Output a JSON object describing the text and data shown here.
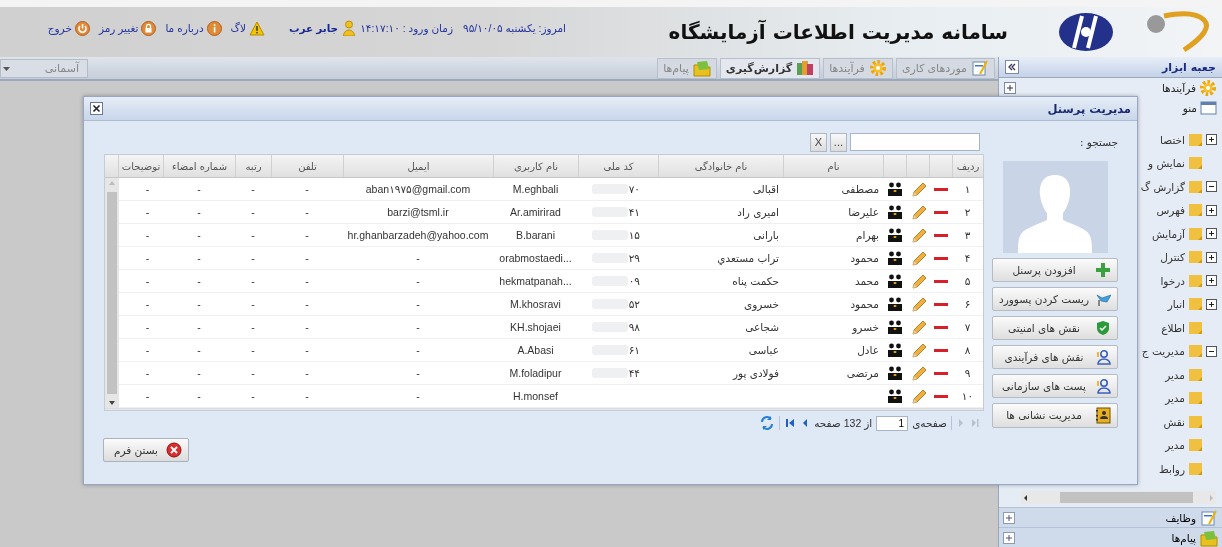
{
  "header": {
    "title": "سامانه مدیریت اطلاعات آزمایشگاه",
    "date": "امروز: یکشنبه ۹۵/۱۰/۰۵",
    "login_time": "زمان ورود : ۱۴:۱۷:۱۰",
    "user": "جابر عرب",
    "links": [
      {
        "label": "لاگ",
        "kind": "warning"
      },
      {
        "label": "درباره ما",
        "kind": "info"
      },
      {
        "label": "تغییر رمز",
        "kind": "lock"
      },
      {
        "label": "خروج",
        "kind": "power"
      }
    ]
  },
  "toolbar": {
    "tabs": [
      {
        "label": "موردهای کاری",
        "selected": false,
        "kind": "tasks"
      },
      {
        "label": "فرآیندها",
        "selected": false,
        "kind": "gear"
      },
      {
        "label": "گزارش‌گیری",
        "selected": true,
        "kind": "report"
      },
      {
        "label": "پیام‌ها",
        "selected": false,
        "kind": "messages"
      }
    ],
    "theme": "آسمانی"
  },
  "sidebar": {
    "title": "جعبه ابزار",
    "sections": [
      {
        "label": "فرآیندها",
        "kind": "gear"
      },
      {
        "label": "منو",
        "kind": "menu"
      }
    ],
    "tree": [
      {
        "label": "اختصا",
        "expanded": false
      },
      {
        "label": "نمایش و"
      },
      {
        "label": "گزارش گ",
        "expanded": true,
        "children": [
          {
            "label": "فهرس",
            "expanded": false
          },
          {
            "label": "آزمایش",
            "expanded": false
          },
          {
            "label": "کنترل",
            "expanded": false
          },
          {
            "label": "درخوا",
            "expanded": false
          },
          {
            "label": "انبار",
            "expanded": false
          },
          {
            "label": "اطلاع"
          }
        ]
      },
      {
        "label": "مدیریت ج",
        "expanded": true,
        "children": [
          {
            "label": "مدیر"
          },
          {
            "label": "مدیر"
          },
          {
            "label": "نقش"
          },
          {
            "label": "مدیر"
          },
          {
            "label": "روابط"
          }
        ]
      }
    ],
    "bottom_sections": [
      {
        "label": "وظایف",
        "kind": "tasks"
      },
      {
        "label": "پیام‌ها",
        "kind": "messages"
      }
    ]
  },
  "modal": {
    "title": "مدیریت پرسنل",
    "search_label": "جستجو :",
    "browse_button": "...",
    "clear_button": "X",
    "table": {
      "columns": [
        "ردیف",
        "نام",
        "نام خانوادگی",
        "کد ملی",
        "نام کاربری",
        "ایمیل",
        "تلفن",
        "رتبه",
        "شماره امضاء",
        "توضیحات"
      ],
      "rows": [
        {
          "row": "۱",
          "first_name": "مصطفی",
          "last_name": "اقبالی",
          "national_code": "۷۰",
          "username": "M.eghbali",
          "email": "aban۱۹۷۵@gmail.com",
          "phone": "-",
          "rank": "-",
          "signature_no": "-",
          "notes": "-"
        },
        {
          "row": "۲",
          "first_name": "علیرضا",
          "last_name": "امیری راد",
          "national_code": "۴۱",
          "username": "Ar.amirirad",
          "email": "barzi@tsml.ir",
          "phone": "-",
          "rank": "-",
          "signature_no": "-",
          "notes": "-"
        },
        {
          "row": "۳",
          "first_name": "بهرام",
          "last_name": "بارانی",
          "national_code": "۱۵",
          "username": "B.barani",
          "email": "hr.ghanbarzadeh@yahoo.com",
          "phone": "-",
          "rank": "-",
          "signature_no": "-",
          "notes": "-"
        },
        {
          "row": "۴",
          "first_name": "محمود",
          "last_name": "تراب مستعدي",
          "national_code": "۲۹",
          "username": "...orabmostaedi",
          "email": "-",
          "phone": "-",
          "rank": "-",
          "signature_no": "-",
          "notes": "-"
        },
        {
          "row": "۵",
          "first_name": "محمد",
          "last_name": "حکمت پناه",
          "national_code": "۰۹",
          "username": "...hekmatpanah",
          "email": "-",
          "phone": "-",
          "rank": "-",
          "signature_no": "-",
          "notes": "-"
        },
        {
          "row": "۶",
          "first_name": "محمود",
          "last_name": "خسروی",
          "national_code": "۵۲",
          "username": "M.khosravi",
          "email": "-",
          "phone": "-",
          "rank": "-",
          "signature_no": "-",
          "notes": "-"
        },
        {
          "row": "۷",
          "first_name": "خسرو",
          "last_name": "شجاعی",
          "national_code": "۹۸",
          "username": "KH.shojaei",
          "email": "-",
          "phone": "-",
          "rank": "-",
          "signature_no": "-",
          "notes": "-"
        },
        {
          "row": "۸",
          "first_name": "عادل",
          "last_name": "عباسی",
          "national_code": "۶۱",
          "username": "A.Abasi",
          "email": "-",
          "phone": "-",
          "rank": "-",
          "signature_no": "-",
          "notes": "-"
        },
        {
          "row": "۹",
          "first_name": "مرتضی",
          "last_name": "فولادی پور",
          "national_code": "۴۴",
          "username": "M.foladipur",
          "email": "-",
          "phone": "-",
          "rank": "-",
          "signature_no": "-",
          "notes": "-"
        },
        {
          "row": "۱۰",
          "username": "H.monsef",
          "email": "-",
          "phone": "-",
          "rank": "-",
          "signature_no": "-",
          "notes": "-"
        }
      ]
    },
    "pager": {
      "page_label": "صفحه‌ی",
      "page": "1",
      "of_pages": "از 132 صفحه"
    },
    "actions": [
      {
        "label": "افزودن پرسنل",
        "kind": "add"
      },
      {
        "label": "ریست کردن پسوورد",
        "kind": "reset"
      },
      {
        "label": "نقش های امنیتی",
        "kind": "shield"
      },
      {
        "label": "نقش های فرآیندی",
        "kind": "users"
      },
      {
        "label": "پست های سازمانی",
        "kind": "users"
      },
      {
        "label": "مدیریت نشانی ها",
        "kind": "addressbook"
      }
    ],
    "close_button": "بستن فرم"
  }
}
